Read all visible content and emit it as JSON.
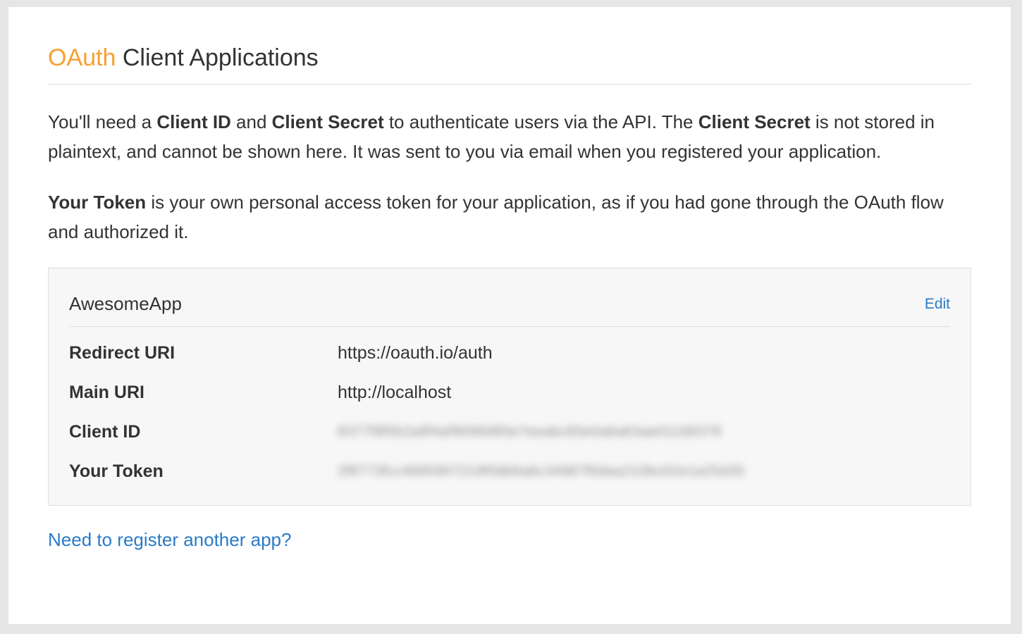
{
  "header": {
    "title_brand": "OAuth",
    "title_rest": "Client Applications"
  },
  "intro": {
    "p1_part1": "You'll need a ",
    "p1_bold1": "Client ID",
    "p1_part2": " and ",
    "p1_bold2": "Client Secret",
    "p1_part3": " to authenticate users via the API. The ",
    "p1_bold3": "Client Secret",
    "p1_part4": " is not stored in plaintext, and cannot be shown here. It was sent to you via email when you registered your application.",
    "p2_bold": "Your Token",
    "p2_text": " is your own personal access token for your application, as if you had gone through the OAuth flow and authorized it."
  },
  "app": {
    "name": "AwesomeApp",
    "edit_label": "Edit",
    "fields": [
      {
        "label": "Redirect URI",
        "value": "https://oauth.io/auth",
        "blurred": false
      },
      {
        "label": "Main URI",
        "value": "http://localhost",
        "blurred": false
      },
      {
        "label": "Client ID",
        "value": "8377f9f5b2a8f4af9096985e7eeabc65e0a6a63ae01168378",
        "blurred": true
      },
      {
        "label": "Your Token",
        "value": "2f8773fcc4685907219f0db6a6c34987f0daa210bc02e1a25d35",
        "blurred": true
      }
    ]
  },
  "footer": {
    "register_link": "Need to register another app?"
  },
  "colors": {
    "brand": "#f7a030",
    "link": "#2a7ac8",
    "text": "#333333"
  }
}
